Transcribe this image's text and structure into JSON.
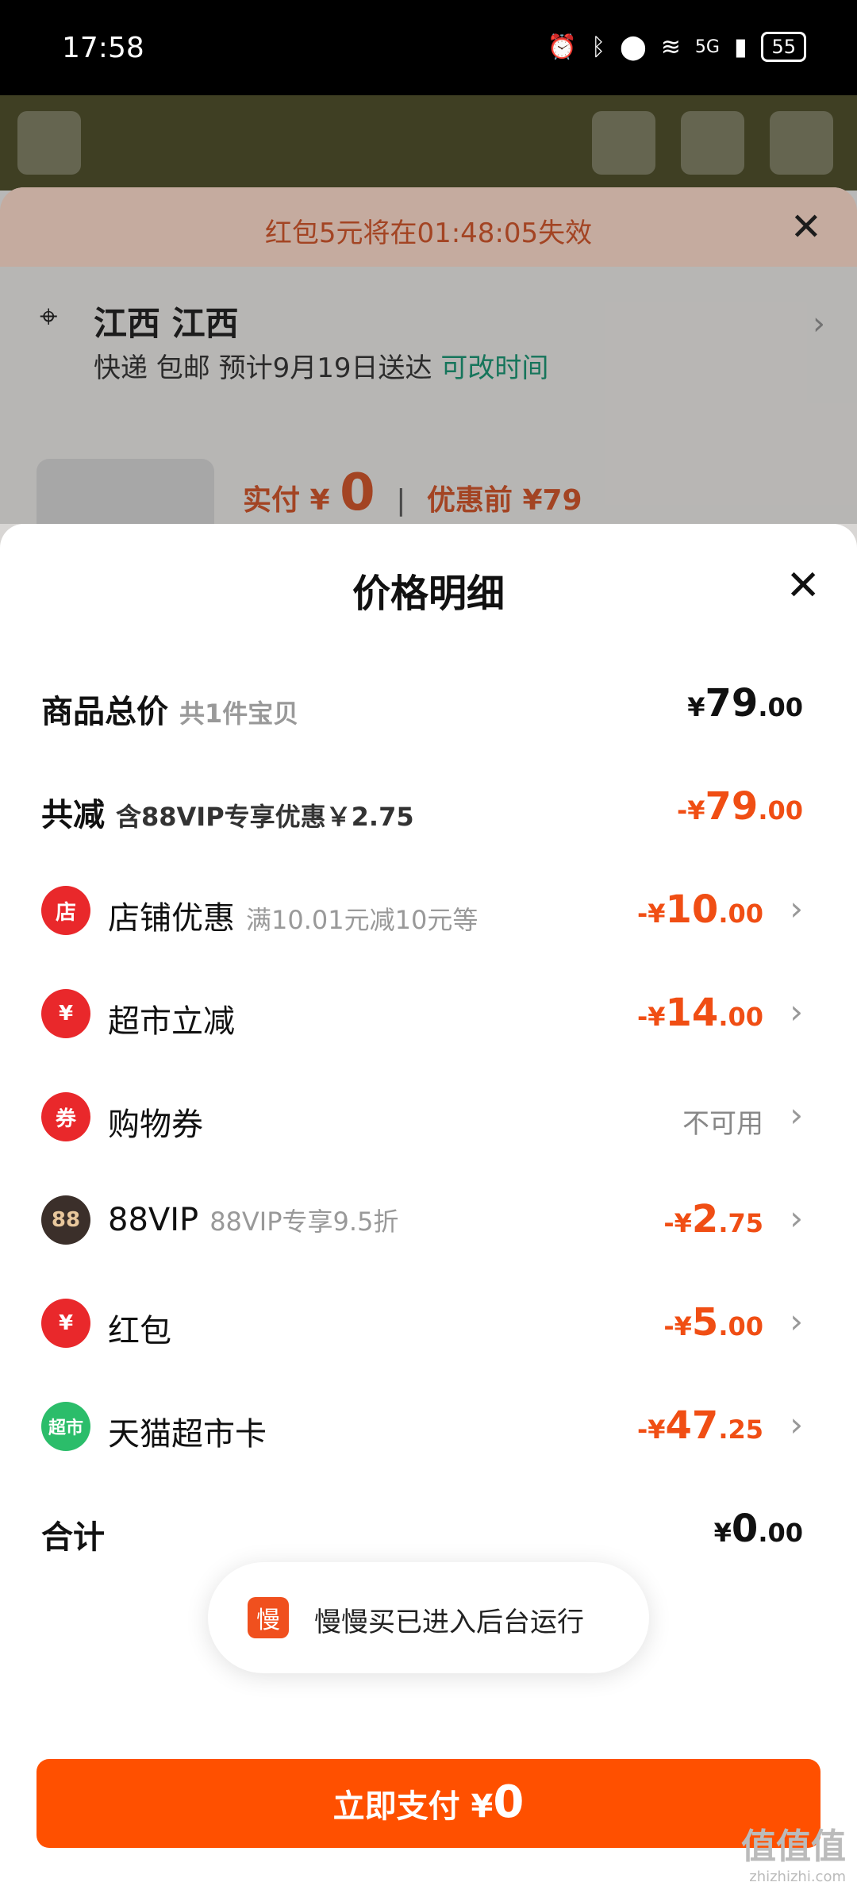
{
  "status_bar": {
    "time": "17:58",
    "network": "5G",
    "battery": "55"
  },
  "background": {
    "coupon_timer": "红包5元将在01:48:05失效",
    "address_name": "江西 江西",
    "shipping_prefix": "快递 包邮 预计9月19日送达",
    "shipping_link": "可改时间",
    "pay_label": "实付 ¥",
    "pay_value": "0",
    "pre_label": "优惠前 ¥79"
  },
  "panel": {
    "title": "价格明细",
    "rows": [
      {
        "label": "商品总价",
        "sub": "共1件宝贝",
        "cur": "¥",
        "int": "79",
        "dec": ".00"
      },
      {
        "label": "共减",
        "sub": "含88VIP专享优惠￥2.75",
        "cur": "-¥",
        "int": "79",
        "dec": ".00"
      },
      {
        "icon": "店",
        "label": "店铺优惠",
        "sub": "满10.01元减10元等",
        "cur": "-¥",
        "int": "10",
        "dec": ".00"
      },
      {
        "icon": "¥",
        "label": "超市立减",
        "sub": "",
        "cur": "-¥",
        "int": "14",
        "dec": ".00"
      },
      {
        "icon": "券",
        "label": "购物券",
        "sub": "",
        "status": "不可用"
      },
      {
        "icon": "88",
        "label": "88VIP",
        "sub": "88VIP专享9.5折",
        "cur": "-¥",
        "int": "2",
        "dec": ".75"
      },
      {
        "icon": "¥",
        "label": "红包",
        "sub": "",
        "cur": "-¥",
        "int": "5",
        "dec": ".00"
      },
      {
        "icon": "超市",
        "label": "天猫超市卡",
        "sub": "",
        "cur": "-¥",
        "int": "47",
        "dec": ".25"
      },
      {
        "label": "合计",
        "cur": "¥",
        "int": "0",
        "dec": ".00"
      }
    ]
  },
  "toast": {
    "icon": "慢",
    "message": "慢慢买已进入后台运行"
  },
  "pay_button": {
    "label": "立即支付 ¥",
    "amount": "0"
  },
  "watermark": {
    "logo": "值值值",
    "site": "zhizhizhi.com"
  },
  "colors": {
    "accent": "#ff5000",
    "discount": "#f04e14",
    "link": "#1b8a6b"
  }
}
